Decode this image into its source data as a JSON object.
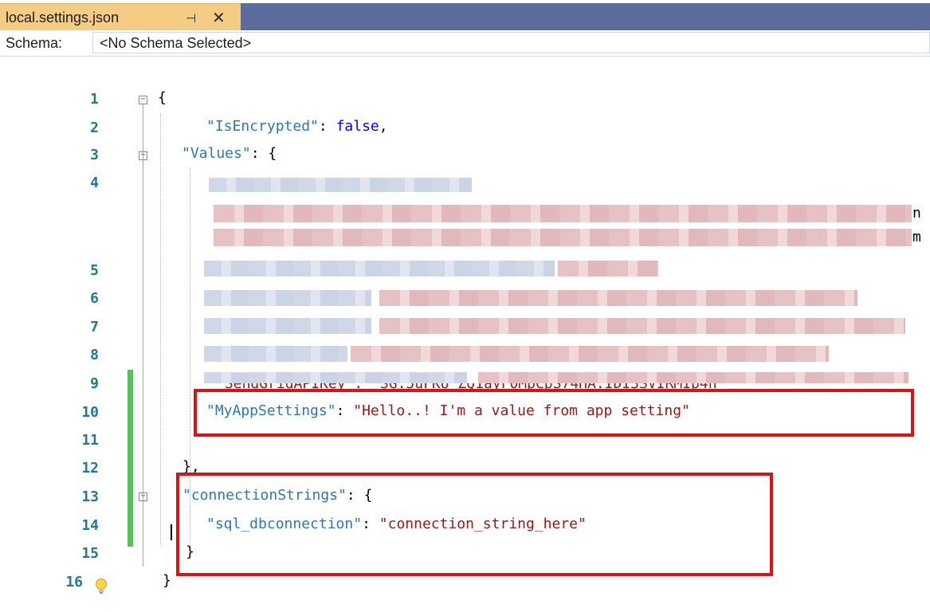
{
  "tab": {
    "title": "local.settings.json",
    "pin_icon": "pin-icon",
    "close_icon": "close-icon"
  },
  "schema": {
    "label": "Schema:",
    "value": "<No Schema Selected>"
  },
  "editor": {
    "line_numbers": [
      "1",
      "2",
      "3",
      "4",
      "5",
      "6",
      "7",
      "8",
      "9",
      "10",
      "11",
      "12",
      "13",
      "14",
      "15",
      "16"
    ],
    "line1": "{",
    "line2_key": "\"IsEncrypted\"",
    "line2_colon": ": ",
    "line2_value": "false",
    "line2_comma": ",",
    "line3_key": "\"Values\"",
    "line3_rest": ": {",
    "line9_partial": "\"SendGridAPIKey\": \"SG.5uFKU_ZQ1ayF0MpCpS74HA.IDI3SVIRMIp4n",
    "line10_key": "\"MyAppSettings\"",
    "line10_colon": ": ",
    "line10_value": "\"Hello..! I'm a value from app setting\"",
    "line12": "},",
    "line13_key": "\"connectionStrings\"",
    "line13_rest": ": {",
    "line14_key": "\"sql_dbconnection\"",
    "line14_colon": ": ",
    "line14_value": "\"connection_string_here\"",
    "line15": "}",
    "line16": "}",
    "overflow_chars": [
      "n",
      "m"
    ],
    "lightbulb_icon": "lightbulb-icon"
  }
}
